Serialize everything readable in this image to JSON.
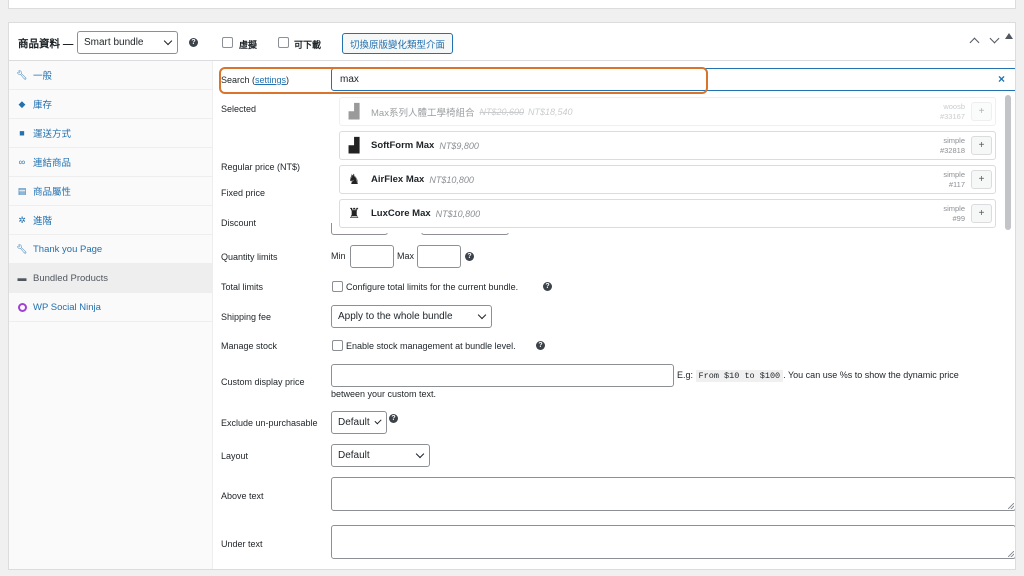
{
  "header": {
    "title": "商品資料 —",
    "product_type": "Smart bundle",
    "virtual_label": "虛擬",
    "downloadable_label": "可下載",
    "switch_button": "切換原版變化類型介面"
  },
  "sidebar": {
    "items": [
      {
        "label": "一般",
        "icon": "wrench-icon"
      },
      {
        "label": "庫存",
        "icon": "tag-icon"
      },
      {
        "label": "運送方式",
        "icon": "truck-icon"
      },
      {
        "label": "連結商品",
        "icon": "link-icon"
      },
      {
        "label": "商品屬性",
        "icon": "table-icon"
      },
      {
        "label": "進階",
        "icon": "gear-icon"
      },
      {
        "label": "Thank you Page",
        "icon": "wrench-icon"
      },
      {
        "label": "Bundled Products",
        "icon": "box-icon"
      },
      {
        "label": "WP Social Ninja",
        "icon": "ninja-icon"
      }
    ]
  },
  "search": {
    "label": "Search (",
    "settings_link": "settings",
    "label_end": ")",
    "value": "max",
    "clear": "×"
  },
  "results": [
    {
      "name": "Max系列人體工學椅組合",
      "price_old": "NT$20,600",
      "price": "NT$18,540",
      "type": "woosb",
      "id": "#33167",
      "dim": true
    },
    {
      "name": "SoftForm Max",
      "price": "NT$9,800",
      "type": "simple",
      "id": "#32818"
    },
    {
      "name": "AirFlex Max",
      "price": "NT$10,800",
      "type": "simple",
      "id": "#117"
    },
    {
      "name": "LuxCore Max",
      "price": "NT$10,800",
      "type": "simple",
      "id": "#99"
    }
  ],
  "add_symbol": "+",
  "fields": {
    "selected": "Selected",
    "regular_price": "Regular price (NT$)",
    "fixed_price": "Fixed price",
    "discount": "Discount",
    "quantity_limits": "Quantity limits",
    "min": "Min",
    "max": "Max",
    "total_limits": "Total limits",
    "total_limits_text": "Configure total limits for the current bundle.",
    "shipping_fee": "Shipping fee",
    "shipping_value": "Apply to the whole bundle",
    "manage_stock": "Manage stock",
    "manage_stock_text": "Enable stock management at bundle level.",
    "custom_display_price": "Custom display price",
    "eg": "E.g:",
    "eg_code": "From $10 to $100",
    "eg_rest": ". You can use %s to show the dynamic price",
    "eg_line2": "between your custom text.",
    "exclude": "Exclude un-purchasable",
    "exclude_value": "Default",
    "layout": "Layout",
    "layout_value": "Default",
    "above_text": "Above text",
    "under_text": "Under text"
  },
  "colors": {
    "accent": "#2271b1",
    "highlight": "#d9742d"
  }
}
